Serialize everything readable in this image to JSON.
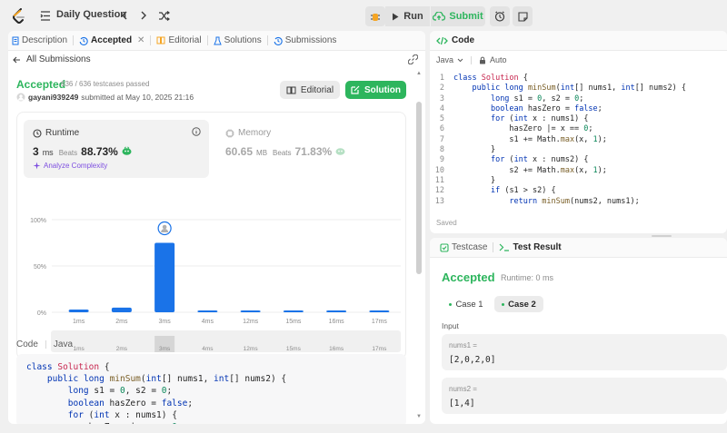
{
  "topbar": {
    "title": "Daily Question",
    "run_label": "Run",
    "submit_label": "Submit"
  },
  "left": {
    "tabs": [
      {
        "label": "Description"
      },
      {
        "label": "Accepted"
      },
      {
        "label": "Editorial"
      },
      {
        "label": "Solutions"
      },
      {
        "label": "Submissions"
      }
    ],
    "back_label": "All Submissions",
    "status": "Accepted",
    "testcases": "636 / 636 testcases passed",
    "username": "gayani939249",
    "submitted_at": "submitted at May 10, 2025 21:16",
    "editorial_btn": "Editorial",
    "solution_btn": "Solution",
    "runtime": {
      "title": "Runtime",
      "value": "3",
      "unit": "ms",
      "beats_label": "Beats",
      "beats": "88.73%",
      "analyze": "Analyze Complexity"
    },
    "memory": {
      "title": "Memory",
      "value": "60.65",
      "unit": "MB",
      "beats_label": "Beats",
      "beats": "71.83%"
    },
    "code_header": {
      "label": "Code",
      "lang": "Java"
    },
    "code_lines": [
      "class Solution {",
      "    public long minSum(int[] nums1, int[] nums2) {",
      "        long s1 = 0, s2 = 0;",
      "        boolean hasZero = false;",
      "        for (int x : nums1) {",
      "            hasZero |= x == 0;"
    ]
  },
  "chart_data": {
    "type": "bar",
    "categories": [
      "1ms",
      "2ms",
      "3ms",
      "4ms",
      "12ms",
      "15ms",
      "16ms",
      "17ms"
    ],
    "values": [
      3,
      5,
      75,
      2,
      2,
      2,
      2,
      2
    ],
    "highlight_category": "3ms",
    "yticks": [
      "100%",
      "50%",
      "0%"
    ],
    "ylim": [
      0,
      100
    ],
    "bar_color": "#1a73e8",
    "navigator_labels": [
      "1ms",
      "2ms",
      "3ms",
      "4ms",
      "12ms",
      "15ms",
      "16ms",
      "17ms"
    ],
    "grid": true
  },
  "code_editor": {
    "tab_label": "Code",
    "language": "Java",
    "mode": "Auto",
    "lines": [
      "class Solution {",
      "    public long minSum(int[] nums1, int[] nums2) {",
      "        long s1 = 0, s2 = 0;",
      "        boolean hasZero = false;",
      "        for (int x : nums1) {",
      "            hasZero |= x == 0;",
      "            s1 += Math.max(x, 1);",
      "        }",
      "        for (int x : nums2) {",
      "            s2 += Math.max(x, 1);",
      "        }",
      "        if (s1 > s2) {",
      "            return minSum(nums2, nums1);"
    ],
    "line_numbers": [
      "1",
      "2",
      "3",
      "4",
      "5",
      "6",
      "7",
      "8",
      "9",
      "10",
      "11",
      "12",
      "13"
    ],
    "saved_label": "Saved"
  },
  "test_panel": {
    "tab_testcase": "Testcase",
    "tab_result": "Test Result",
    "status": "Accepted",
    "runtime": "Runtime: 0 ms",
    "case1": "Case 1",
    "case2": "Case 2",
    "input_label": "Input",
    "params": [
      {
        "name": "nums1 =",
        "value": "[2,0,2,0]"
      },
      {
        "name": "nums2 =",
        "value": "[1,4]"
      }
    ]
  },
  "colors": {
    "accent_green": "#2db55d",
    "bar_blue": "#1a73e8",
    "purple": "#7d4ee0"
  }
}
